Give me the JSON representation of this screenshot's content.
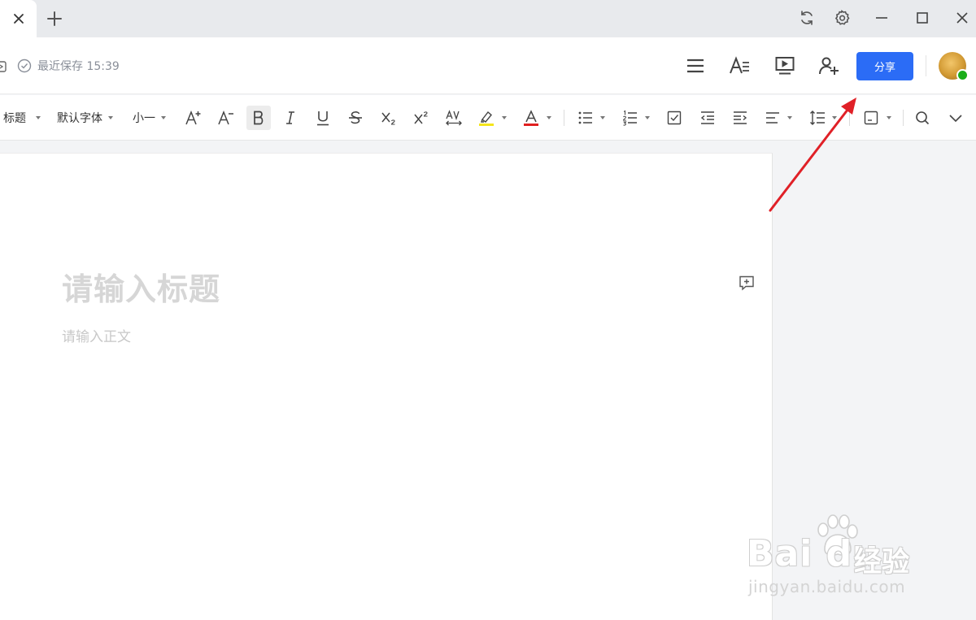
{
  "tabbar": {
    "close_icon": "close-icon",
    "new_tab_icon": "plus-icon",
    "window_controls": [
      "sync-icon",
      "settings-icon",
      "minimize-icon",
      "maximize-icon",
      "close-icon"
    ]
  },
  "header": {
    "save_status": "最近保存 15:39",
    "share_label": "分享",
    "icons": [
      "menu-icon",
      "text-style-icon",
      "present-icon",
      "add-collaborator-icon"
    ],
    "share_color": "#2b6cf6"
  },
  "toolbar": {
    "style_select": "标题",
    "font_select": "默认字体",
    "size_select": "小一"
  },
  "document": {
    "title_placeholder": "请输入标题",
    "body_placeholder": "请输入正文"
  },
  "colors": {
    "highlight": "#f5e51b",
    "font_color": "#e02020",
    "annotation_arrow": "#e02027"
  },
  "watermark": {
    "brand": "Bai du",
    "cn": "经验",
    "url": "jingyan.baidu.com"
  }
}
